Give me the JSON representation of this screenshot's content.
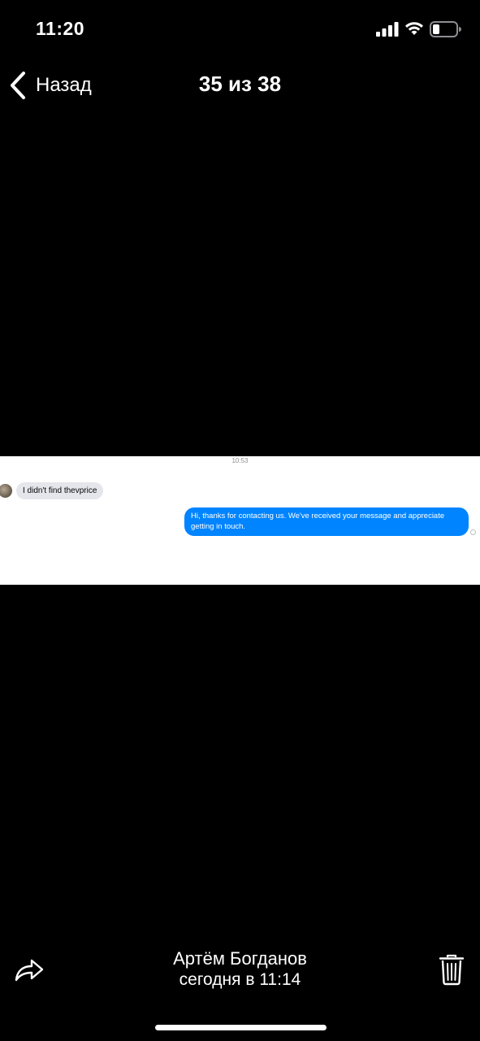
{
  "status_bar": {
    "time": "11:20",
    "icons": [
      "signal-icon",
      "wifi-icon",
      "battery-icon"
    ]
  },
  "nav": {
    "back_label": "Назад",
    "title": "35 из 38"
  },
  "photo": {
    "chat": {
      "timestamp": "10:53",
      "incoming_message": "I didn't find thevprice",
      "outgoing_message": "Hi, thanks for contacting us. We've received your message and appreciate getting in touch.",
      "incoming_bubble_color": "#e4e6eb",
      "outgoing_bubble_color": "#0084ff"
    }
  },
  "footer": {
    "sender_name": "Артём Богданов",
    "sent_time": "сегодня в 11:14",
    "icons": [
      "share-icon",
      "trash-icon"
    ]
  },
  "colors": {
    "background": "#000000",
    "text": "#ffffff"
  }
}
